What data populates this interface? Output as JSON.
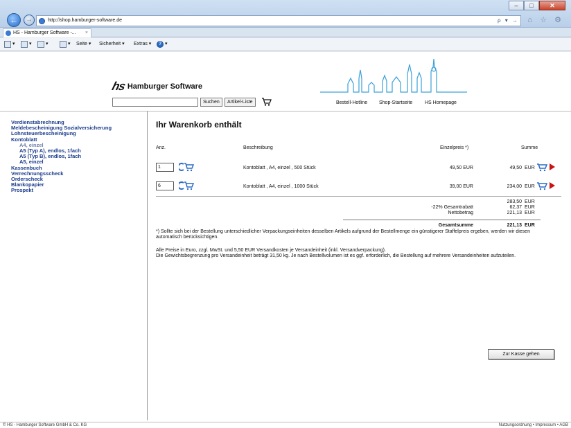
{
  "browser": {
    "url": "http://shop.hamburger-software.de",
    "tab_title": "HS - Hamburger Software -...",
    "tab_close": "×",
    "window_controls": {
      "minimize": "–",
      "maximize": "□",
      "close": "✕"
    },
    "address_tools": "ρ ▾ →",
    "right_icons": "⌂ ☆ ⚙",
    "commands": {
      "page": "Seite ▾",
      "security": "Sicherheit ▾",
      "extras": "Extras ▾"
    }
  },
  "header": {
    "logo_mark": "hs",
    "logo_text": "Hamburger Software",
    "search_button": "Suchen",
    "article_list_button": "Artikel-Liste",
    "links": [
      "Bestell-Hotline",
      "Shop-Startseite",
      "HS Homepage"
    ]
  },
  "sidebar": {
    "items": [
      {
        "label": "Verdienstabrechnung",
        "level": 0
      },
      {
        "label": "Meldebescheinigung Sozialversicherung",
        "level": 0
      },
      {
        "label": "Lohnsteuerbescheinigung",
        "level": 0
      },
      {
        "label": "Kontoblatt",
        "level": 0
      },
      {
        "label": "A4, einzel",
        "level": 1,
        "active": true
      },
      {
        "label": "A5 (Typ A), endlos, 1fach",
        "level": 1
      },
      {
        "label": "A5 (Typ B), endlos, 1fach",
        "level": 1
      },
      {
        "label": "A5, einzel",
        "level": 1
      },
      {
        "label": "Kassenbuch",
        "level": 0
      },
      {
        "label": "Verrechnungsscheck",
        "level": 0
      },
      {
        "label": "Orderscheck",
        "level": 0
      },
      {
        "label": "Blankopapier",
        "level": 0
      },
      {
        "label": "Prospekt",
        "level": 0
      }
    ]
  },
  "cart": {
    "title": "Ihr Warenkorb enthält",
    "columns": {
      "qty": "Anz.",
      "description": "Beschreibung",
      "unit_price": "Einzelpreis *)",
      "total": "Summe"
    },
    "rows": [
      {
        "qty": "1",
        "description": "Kontoblatt , A4, einzel , 500 Stück",
        "unit_price": "49,50 EUR",
        "total": "49,50",
        "currency": "EUR"
      },
      {
        "qty": "6",
        "description": "Kontoblatt , A4, einzel , 1000 Stück",
        "unit_price": "39,00 EUR",
        "total": "234,00",
        "currency": "EUR"
      }
    ],
    "summary": {
      "subtotal": "283,50",
      "subtotal_currency": "EUR",
      "discount_label": "-22% Gesamtrabatt",
      "discount": "62,37",
      "discount_currency": "EUR",
      "net_label": "Nettobetrag",
      "net": "221,13",
      "net_currency": "EUR",
      "grand_label": "Gesamtsumme",
      "grand": "221,13",
      "grand_currency": "EUR"
    },
    "note_1": "*) Sollte sich bei der Bestellung unterschiedlicher Verpackungseinheiten desselben Artikels aufgrund der Bestellmenge ein günstigerer Staffelpreis ergeben, werden wir diesen automatisch berücksichtigen.",
    "note_2a": "Alle Preise in Euro, zzgl. MwSt. und 5,50 EUR Versandkosten je Versandeinheit (inkl. Versandverpackung).",
    "note_2b": "Die Gewichtsbegrenzung pro Versandeinheit beträgt 31,50 kg. Je nach Bestellvolumen ist es ggf. erforderlich, die Bestellung auf mehrere Versandeinheiten aufzuteilen.",
    "checkout_button": "Zur Kasse gehen"
  },
  "footer": {
    "copyright": "© HS - Hamburger Software GmbH & Co. KG",
    "links": "Nutzungsordnung • Impressum • AGB"
  },
  "colors": {
    "link": "#1a3a8c",
    "accent_red": "#cc1111",
    "skyline": "#3aa0d8"
  }
}
